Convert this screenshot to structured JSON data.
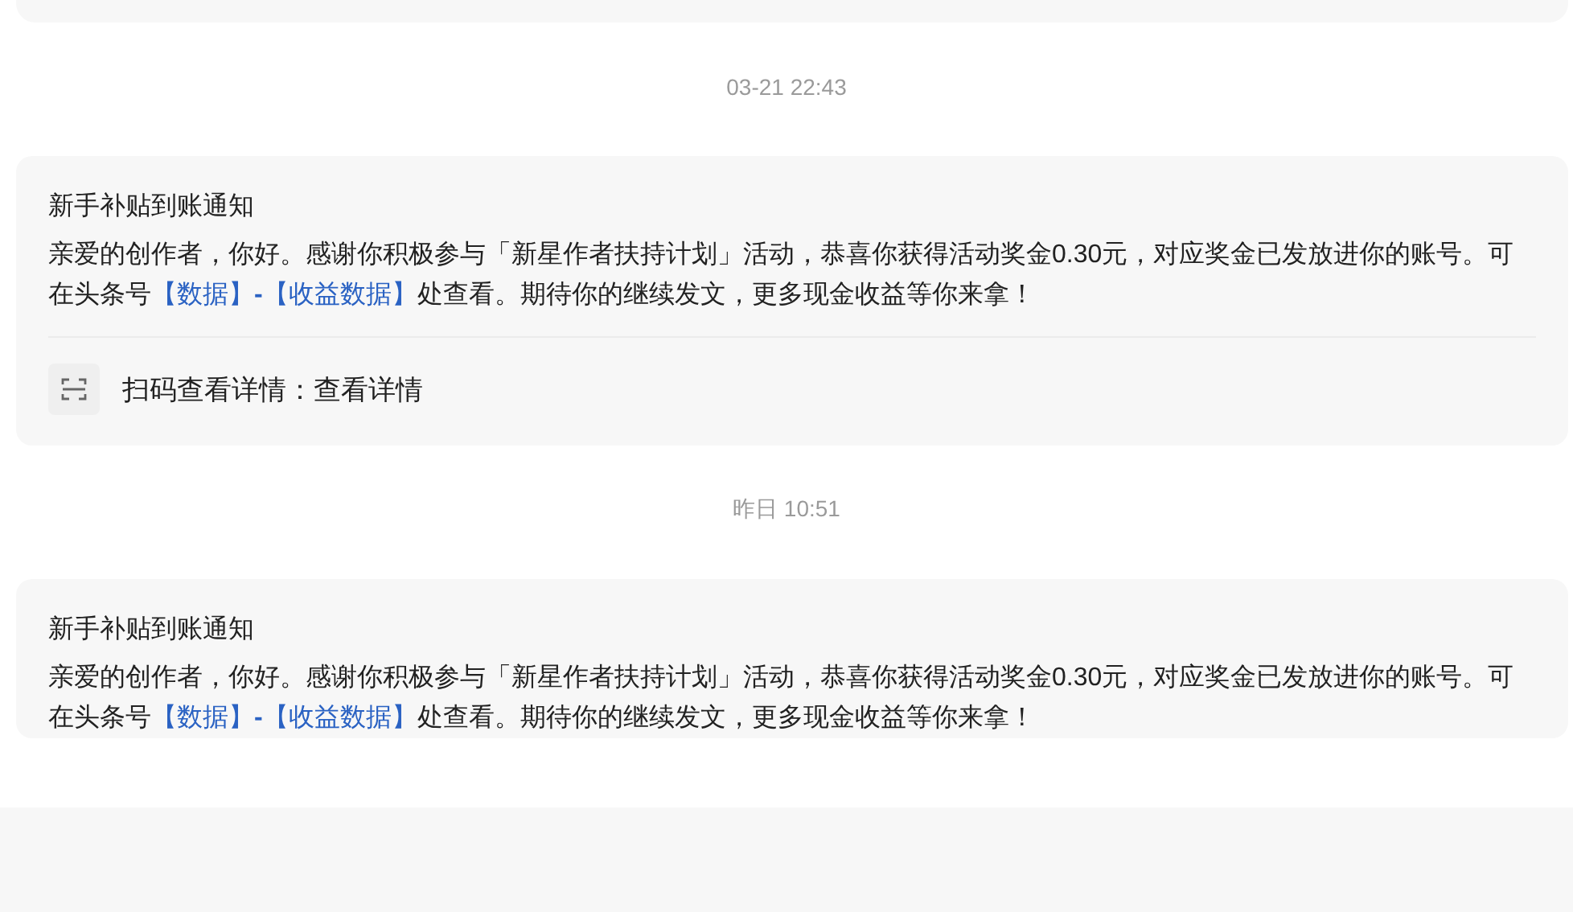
{
  "messages": [
    {
      "time": "03-21 22:43",
      "title": "新手补贴到账通知",
      "body": [
        {
          "kind": "text",
          "text": "亲爱的创作者，你好。感谢你积极参与「新星作者扶持计划」活动，恭喜你获得活动奖金0.30元，对应奖金已发放进你的账号。可在头条号"
        },
        {
          "kind": "link",
          "text": "【数据】"
        },
        {
          "kind": "separator",
          "text": "-"
        },
        {
          "kind": "link",
          "text": "【收益数据】"
        },
        {
          "kind": "text",
          "text": "处查看。期待你的继续发文，更多现金收益等你来拿！"
        }
      ],
      "footer": "扫码查看详情：查看详情"
    },
    {
      "time": "昨日 10:51",
      "title": "新手补贴到账通知",
      "body": [
        {
          "kind": "text",
          "text": "亲爱的创作者，你好。感谢你积极参与「新星作者扶持计划」活动，恭喜你获得活动奖金0.30元，对应奖金已发放进你的账号。可在头条号"
        },
        {
          "kind": "link",
          "text": "【数据】"
        },
        {
          "kind": "separator",
          "text": "-"
        },
        {
          "kind": "link",
          "text": "【收益数据】"
        },
        {
          "kind": "text",
          "text": "处查看。期待你的继续发文，更多现金收益等你来拿！"
        }
      ]
    }
  ]
}
